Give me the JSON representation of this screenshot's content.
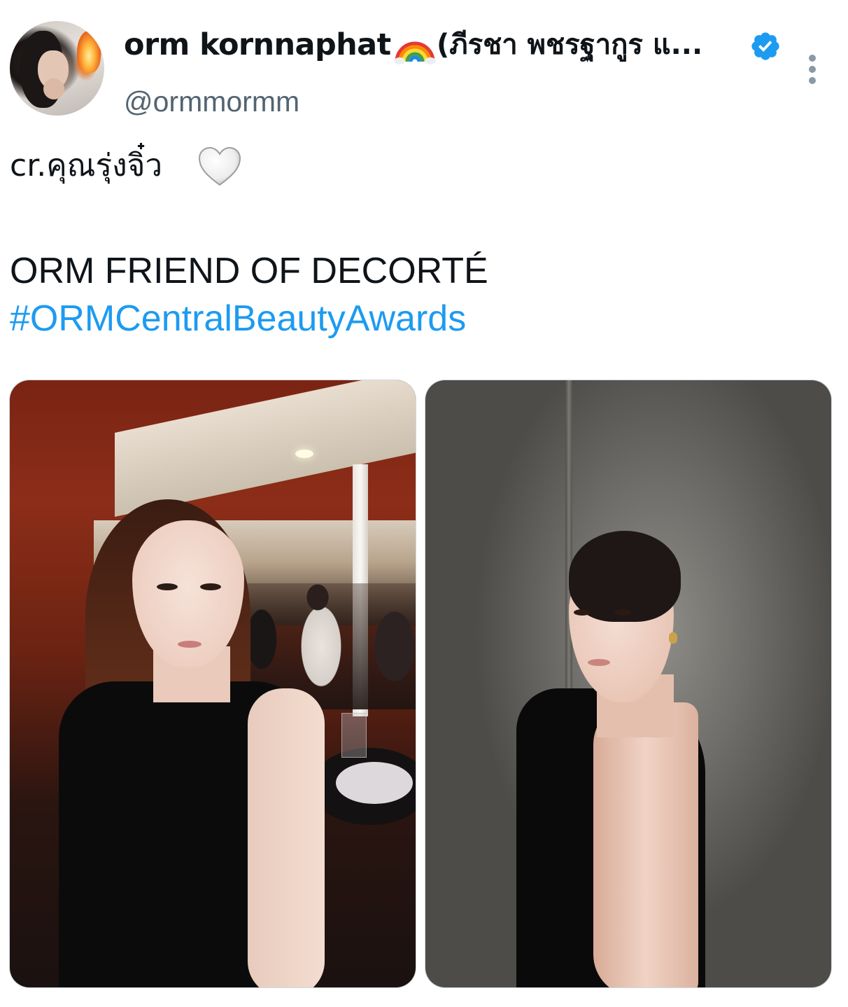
{
  "author": {
    "display_name": "orm kornnaphat",
    "display_name_emoji": "rainbow-icon",
    "display_name_thai": "(ภีรชา พชรฐากูร แ...",
    "handle": "@ormmormm",
    "verified": true,
    "verified_color": "#1d9bf0"
  },
  "tweet": {
    "line1": "cr.คุณรุ่งจิ๋ว",
    "line1_emoji": "white-heart-icon",
    "line2": "ORM FRIEND OF DECORTÉ",
    "hashtag": "#ORMCentralBeautyAwards",
    "hashtag_color": "#1d9bf0"
  },
  "media": {
    "count": 2,
    "items": [
      {
        "kind": "photo",
        "subject": "portrait-event-venue"
      },
      {
        "kind": "photo",
        "subject": "portrait-gray-wall"
      }
    ]
  },
  "menu": {
    "icon": "more-vertical-icon"
  }
}
